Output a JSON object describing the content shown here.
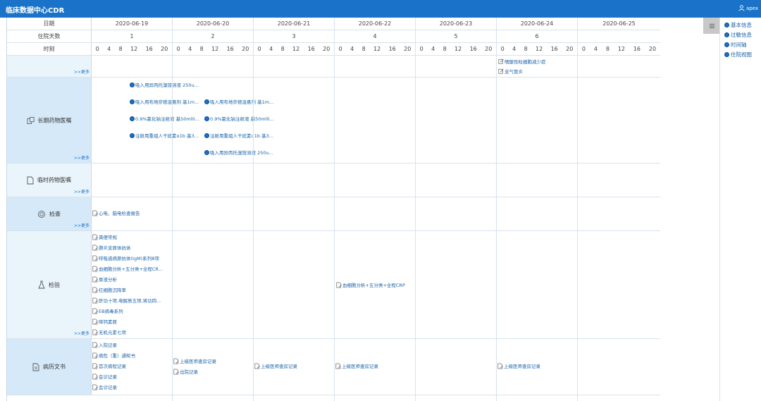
{
  "app": {
    "title": "临床数据中心CDR",
    "user": "apex"
  },
  "header": {
    "date_label": "日期",
    "days_label": "住院天数",
    "time_label": "时刻",
    "dates": [
      "2020-06-19",
      "2020-06-20",
      "2020-06-21",
      "2020-06-22",
      "2020-06-23",
      "2020-06-24",
      "2020-06-25"
    ],
    "day_numbers": [
      "1",
      "2",
      "3",
      "4",
      "5",
      "6",
      ""
    ],
    "hours": [
      "0",
      "4",
      "8",
      "12",
      "16",
      "20"
    ]
  },
  "rows": {
    "diagnosis": {
      "more": ">>更多",
      "items": [
        {
          "day": 5,
          "text": "嗜酸性粒细胞减少症"
        },
        {
          "day": 5,
          "text": "支气管炎"
        }
      ]
    },
    "long_term": {
      "label": "长期药物医嘱",
      "more": ">>更多",
      "items": [
        {
          "col": 0,
          "line": 0,
          "text": "吸入用异丙托溴铵溶液 250u..."
        },
        {
          "col": 0,
          "line": 1,
          "text": "吸入用布地奈德混悬剂 基1m..."
        },
        {
          "col": 1,
          "line": 1,
          "text": "吸入用布地奈德混悬剂 基1m..."
        },
        {
          "col": 0,
          "line": 2,
          "text": "0.9%氯化钠注射液 基50ml0..."
        },
        {
          "col": 1,
          "line": 2,
          "text": "0.9%氯化钠注射液 基50ml0..."
        },
        {
          "col": 0,
          "line": 3,
          "text": "注射用重组人干扰素α1b 基3..."
        },
        {
          "col": 1,
          "line": 3,
          "text": "注射用重组人干扰素α1b 基3..."
        },
        {
          "col": 1,
          "line": 4,
          "text": "吸入用异丙托溴铵溶液 250u..."
        }
      ]
    },
    "temporary": {
      "label": "临时药物医嘱",
      "more": ">>更多"
    },
    "exam": {
      "label": "检查",
      "more": ">>更多",
      "items": [
        "心电、脑电检查报告"
      ]
    },
    "lab": {
      "label": "检验",
      "more": ">>更多",
      "items": [
        "粪便常规",
        "肺炎支原体抗体",
        "呼吸道病原抗体(IgM)系列8项",
        "血细胞分析+五分类+全程CR...",
        "尿液分析",
        "红细胞沉降率",
        "肝功十项,电解质五项,肾功四...",
        "EB病毒系列",
        "降钙素原",
        "无机元素七项"
      ],
      "day4": "血细胞分析+五分类+全程CRP"
    },
    "records": {
      "label": "病历文书",
      "day1": [
        "入院记录",
        "病危（重）通知书",
        "首次病程记录",
        "会诊记录",
        "会诊记录"
      ],
      "day2": [
        "上级医师查房记录",
        "出院记录"
      ],
      "day3": [
        "上级医师查房记录"
      ],
      "day4": [
        "上级医师查房记录"
      ],
      "day6": [
        "上级医师查房记录"
      ]
    }
  },
  "sidebar": {
    "items": [
      "基本信息",
      "过敏信息",
      "时间轴",
      "住院视图"
    ]
  },
  "colors": {
    "topbar": "#1a73c8",
    "label_bg": "#d6e9f8",
    "link": "#1a63a8"
  }
}
